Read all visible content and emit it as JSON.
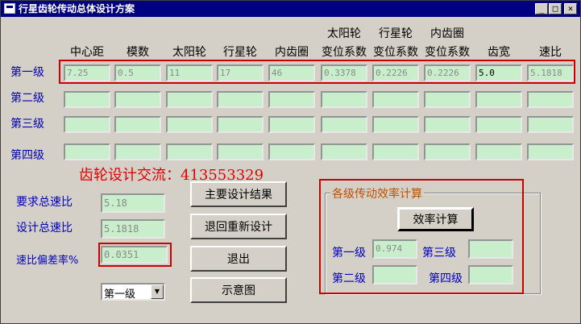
{
  "window": {
    "title": "行星齿轮传动总体设计方案",
    "icon": "app-icon"
  },
  "title_buttons": {
    "minimize": "_",
    "maximize": "□",
    "close": "×"
  },
  "table": {
    "header_top": [
      "",
      "",
      "",
      "",
      "",
      "太阳轮",
      "行星轮",
      "内齿圈",
      "",
      ""
    ],
    "header_bottom": [
      "中心距",
      "模数",
      "太阳轮",
      "行星轮",
      "内齿圈",
      "变位系数",
      "变位系数",
      "变位系数",
      "齿宽",
      "速比"
    ],
    "rows": [
      {
        "label": "第一级",
        "values": [
          "7.25",
          "0.5",
          "11",
          "17",
          "46",
          "0.3378",
          "0.2226",
          "0.2226",
          "5.0",
          "5.1818"
        ]
      },
      {
        "label": "第二级",
        "values": [
          "",
          "",
          "",
          "",
          "",
          "",
          "",
          "",
          "",
          ""
        ]
      },
      {
        "label": "第三级",
        "values": [
          "",
          "",
          "",
          "",
          "",
          "",
          "",
          "",
          "",
          ""
        ]
      },
      {
        "label": "第四级",
        "values": [
          "",
          "",
          "",
          "",
          "",
          "",
          "",
          "",
          "",
          ""
        ]
      }
    ]
  },
  "watermark": "齿轮设计交流：413553329",
  "ratio": {
    "required_label": "要求总速比",
    "required_value": "5.18",
    "design_label": "设计总速比",
    "design_value": "5.1818",
    "deviation_label": "速比偏差率%",
    "deviation_value": "0.0351"
  },
  "buttons": {
    "main_results": "主要设计结果",
    "redesign": "退回重新设计",
    "exit": "退出",
    "diagram": "示意图"
  },
  "stage_select": {
    "selected": "第一级"
  },
  "efficiency": {
    "group_title": "各级传动效率计算",
    "calc_button": "效率计算",
    "stage1_label": "第一级",
    "stage1_value": "0.974",
    "stage2_label": "第二级",
    "stage2_value": "",
    "stage3_label": "第三级",
    "stage3_value": "",
    "stage4_label": "第四级",
    "stage4_value": ""
  },
  "colors": {
    "title_bar": "#000080",
    "field_bg": "#c8eecc",
    "highlight_red": "#c80000",
    "label_blue": "#0000c0",
    "group_title": "#c05000"
  }
}
